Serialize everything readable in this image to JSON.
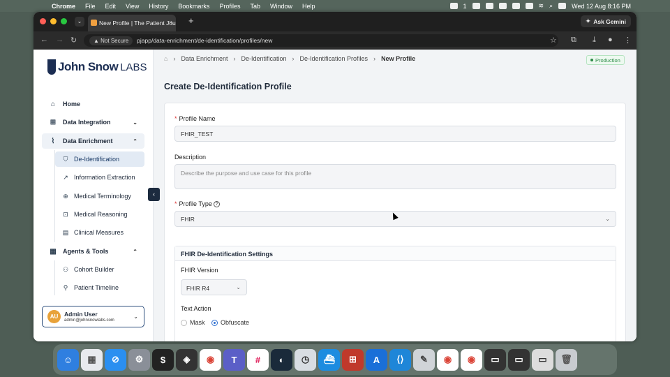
{
  "menubar": {
    "app": "Chrome",
    "items": [
      "File",
      "Edit",
      "View",
      "History",
      "Bookmarks",
      "Profiles",
      "Tab",
      "Window",
      "Help"
    ],
    "status_badge": "1",
    "clock": "Wed 12 Aug  8:16 PM"
  },
  "browser": {
    "tab_title": "New Profile | The Patient Jou",
    "ask_gemini": "Ask Gemini",
    "not_secure": "Not Secure",
    "url": "pjapp/data-enrichment/de-identification/profiles/new"
  },
  "sidebar": {
    "logo_main": "John Snow",
    "logo_labs": "LABS",
    "home": "Home",
    "data_integration": "Data Integration",
    "data_enrichment": "Data Enrichment",
    "enrichment_items": [
      "De-Identification",
      "Information Extraction",
      "Medical Terminology",
      "Medical Reasoning",
      "Clinical Measures"
    ],
    "agents_tools": "Agents & Tools",
    "agent_items": [
      "Cohort Builder",
      "Patient Timeline"
    ],
    "user_name": "Admin User",
    "user_email": "admin@johnsnowlabs.com",
    "user_initials": "AU"
  },
  "breadcrumb": [
    "Data Enrichment",
    "De-Identification",
    "De-Identification Profiles",
    "New Profile"
  ],
  "env_badge": "Production",
  "page_title": "Create De-Identification Profile",
  "form": {
    "profile_name_label": "Profile Name",
    "profile_name_value": "FHIR_TEST",
    "description_label": "Description",
    "description_placeholder": "Describe the purpose and use case for this profile",
    "profile_type_label": "Profile Type",
    "profile_type_value": "FHIR",
    "fhir_settings_title": "FHIR De-Identification Settings",
    "fhir_version_label": "FHIR Version",
    "fhir_version_value": "FHIR R4",
    "text_action_label": "Text Action",
    "text_action_options": [
      "Mask",
      "Obfuscate"
    ],
    "text_action_selected": "Obfuscate"
  }
}
